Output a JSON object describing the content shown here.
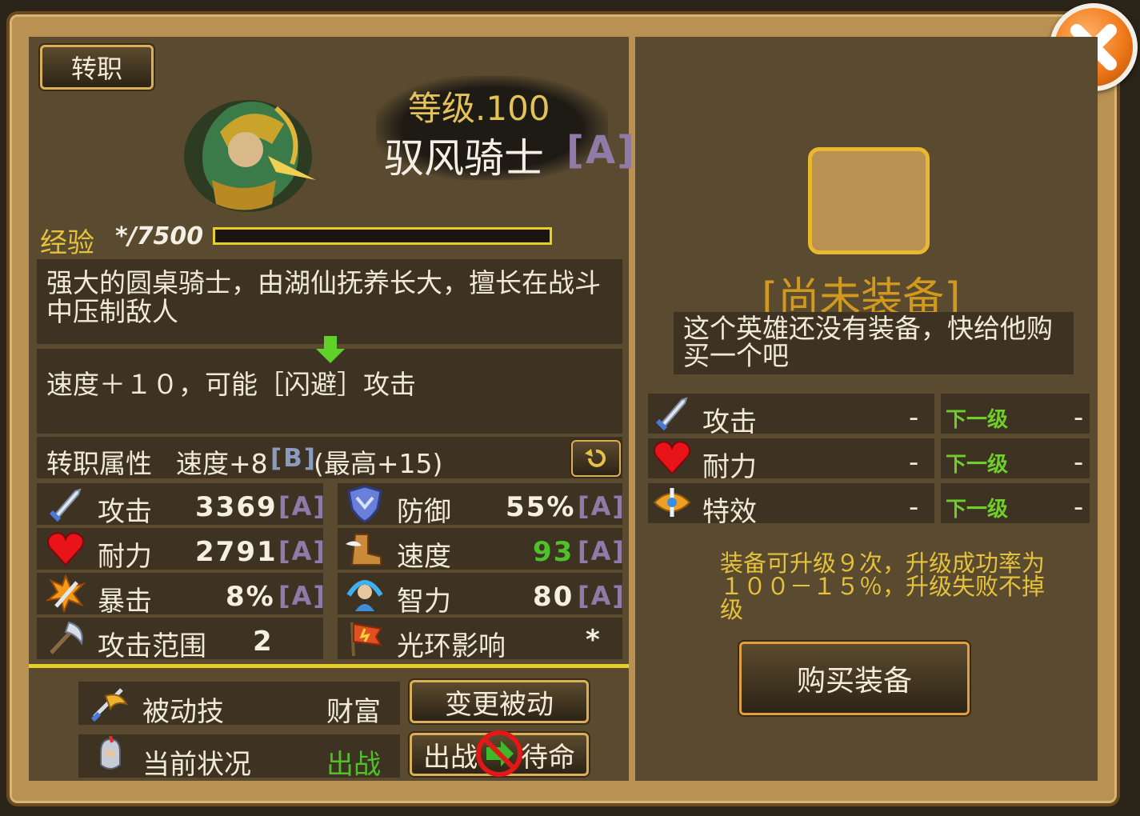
{
  "header": {
    "job_change_button": "转职",
    "level_text": "等级.100",
    "hero_name": "驭风骑士",
    "hero_grade": "[A]",
    "exp_label": "经验",
    "exp_value": "*/7500",
    "exp_progress": 0
  },
  "description": "强大的圆桌骑士，由湖仙抚养长大，擅长在战斗中压制敌人",
  "skill_text": "速度＋１０，可能［闪避］攻击",
  "job_attr": {
    "label": "转职属性",
    "speed": "速度+8",
    "grade": "[B]",
    "max": "(最高+15)"
  },
  "stats": {
    "attack": {
      "label": "攻击",
      "value": "3369",
      "grade": "[A]"
    },
    "defense": {
      "label": "防御",
      "value": "55%",
      "grade": "[A]"
    },
    "stamina": {
      "label": "耐力",
      "value": "2791",
      "grade": "[A]"
    },
    "speed": {
      "label": "速度",
      "value": "93",
      "grade": "[A]"
    },
    "crit": {
      "label": "暴击",
      "value": "8%",
      "grade": "[A]"
    },
    "intellect": {
      "label": "智力",
      "value": "80",
      "grade": "[A]"
    },
    "attack_range": {
      "label": "攻击范围",
      "value": "2"
    },
    "aura": {
      "label": "光环影响",
      "value": "*"
    }
  },
  "passive": {
    "label": "被动技",
    "value": "财富",
    "change_button": "变更被动"
  },
  "status": {
    "label": "当前状况",
    "value": "出战",
    "toggle_button_left": "出战",
    "toggle_button_right": "待命"
  },
  "equipment": {
    "title": "[尚未装备]",
    "desc": "这个英雄还没有装备，快给他购买一个吧",
    "rows": [
      {
        "label": "攻击",
        "value": "-",
        "next_label": "下一级",
        "next_value": "-"
      },
      {
        "label": "耐力",
        "value": "-",
        "next_label": "下一级",
        "next_value": "-"
      },
      {
        "label": "特效",
        "value": "-",
        "next_label": "下一级",
        "next_value": "-"
      }
    ],
    "upgrade_note": "装备可升级９次，升级成功率为１００－１５％，升级失败不掉级",
    "buy_button": "购买装备"
  },
  "colors": {
    "grade": "#8f7aa8",
    "yellow": "#d8c04a",
    "green": "#4ec228",
    "gold_border": "#d9b05a",
    "equip_title": "#d19a1e"
  }
}
